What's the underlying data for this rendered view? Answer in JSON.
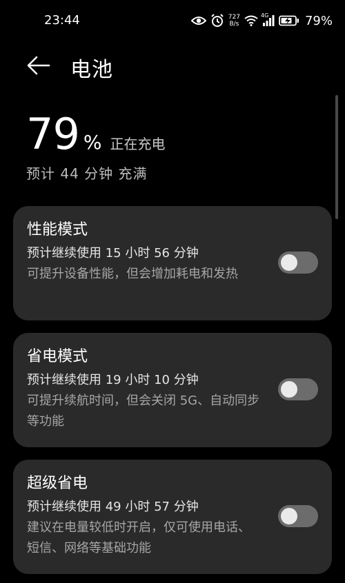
{
  "status_bar": {
    "time": "23:44",
    "net_speed_value": "727",
    "net_speed_unit": "B/s",
    "network_type": "4G",
    "battery_text": "79%"
  },
  "header": {
    "title": "电池"
  },
  "battery": {
    "percent": "79",
    "unit": "%",
    "status": "正在充电",
    "eta": "预计 44 分钟 充满"
  },
  "modes": [
    {
      "title": "性能模式",
      "eta": "预计继续使用 15 小时 56 分钟",
      "desc": "可提升设备性能，但会增加耗电和发热",
      "enabled": false
    },
    {
      "title": "省电模式",
      "eta": "预计继续使用 19 小时 10 分钟",
      "desc": "可提升续航时间，但会关闭 5G、自动同步等功能",
      "enabled": false
    },
    {
      "title": "超级省电",
      "eta": "预计继续使用 49 小时 57 分钟",
      "desc": "建议在电量较低时开启，仅可使用电话、短信、网络等基础功能",
      "enabled": false
    }
  ],
  "colors": {
    "background": "#000000",
    "card": "#2a2a2a",
    "toggle_off": "#6c6c6c"
  }
}
